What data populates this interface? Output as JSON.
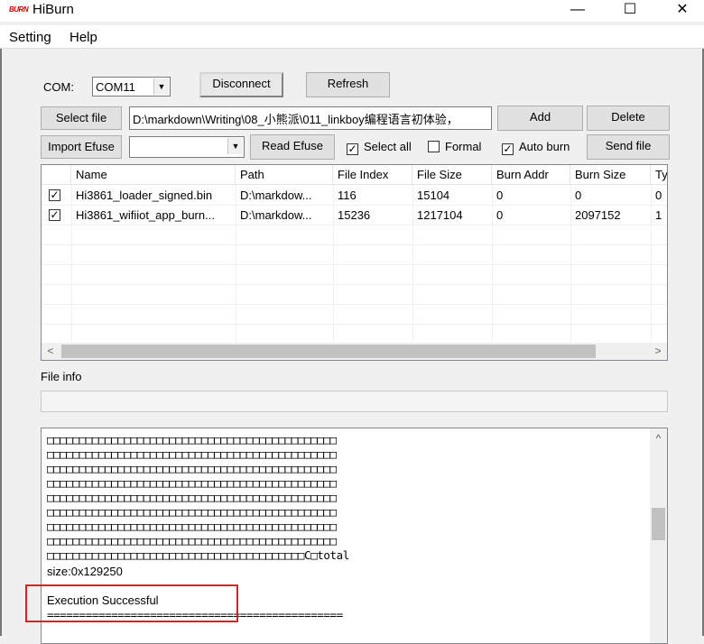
{
  "window": {
    "title": "HiBurn",
    "icon_text": "BURN",
    "minimize": "—",
    "maximize": "☐",
    "close": "✕"
  },
  "menu": {
    "items": [
      "Setting",
      "Help"
    ]
  },
  "com": {
    "label": "COM:",
    "port": "COM11",
    "disconnect": "Disconnect",
    "refresh": "Refresh"
  },
  "file_row": {
    "select_file": "Select file",
    "path": "D:\\markdown\\Writing\\08_小熊派\\011_linkboy编程语言初体验，",
    "add": "Add",
    "delete": "Delete"
  },
  "efuse_row": {
    "import_efuse": "Import Efuse",
    "efuse_value": "",
    "read_efuse": "Read Efuse",
    "select_all": {
      "label": "Select all",
      "checked": true
    },
    "formal": {
      "label": "Formal",
      "checked": false
    },
    "auto_burn": {
      "label": "Auto burn",
      "checked": true
    },
    "send_file": "Send file"
  },
  "table": {
    "columns": [
      "",
      "Name",
      "Path",
      "File Index",
      "File Size",
      "Burn Addr",
      "Burn Size",
      "Ty"
    ],
    "rows": [
      {
        "checked": true,
        "name": "Hi3861_loader_signed.bin",
        "path": "D:\\markdow...",
        "file_index": "116",
        "file_size": "15104",
        "burn_addr": "0",
        "burn_size": "0",
        "type": "0"
      },
      {
        "checked": true,
        "name": "Hi3861_wifiiot_app_burn...",
        "path": "D:\\markdow...",
        "file_index": "15236",
        "file_size": "1217104",
        "burn_addr": "0",
        "burn_size": "2097152",
        "type": "1"
      }
    ]
  },
  "file_info": {
    "label": "File info",
    "value": ""
  },
  "log": {
    "box_line": "□□□□□□□□□□□□□□□□□□□□□□□□□□□□□□□□□□□□□□□□□□□□□",
    "last_box_line": "□□□□□□□□□□□□□□□□□□□□□□□□□□□□□□□□□□□□□□□□C□total",
    "size_line": "size:0x129250",
    "status": "Execution Successful",
    "separator": "=============================================="
  },
  "colors": {
    "highlight": "#e02020"
  }
}
